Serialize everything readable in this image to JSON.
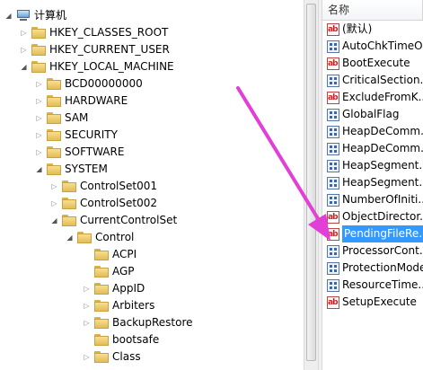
{
  "tree": {
    "items": [
      {
        "label": "计算机",
        "icon": "computer-icon",
        "expander": "expanded",
        "level": 0
      },
      {
        "label": "HKEY_CLASSES_ROOT",
        "icon": "folder-icon",
        "expander": "collapsed",
        "level": 1
      },
      {
        "label": "HKEY_CURRENT_USER",
        "icon": "folder-icon",
        "expander": "collapsed",
        "level": 1
      },
      {
        "label": "HKEY_LOCAL_MACHINE",
        "icon": "folder-icon",
        "expander": "expanded",
        "level": 1
      },
      {
        "label": "BCD00000000",
        "icon": "folder-icon",
        "expander": "collapsed",
        "level": 2
      },
      {
        "label": "HARDWARE",
        "icon": "folder-icon",
        "expander": "collapsed",
        "level": 2
      },
      {
        "label": "SAM",
        "icon": "folder-icon",
        "expander": "collapsed",
        "level": 2
      },
      {
        "label": "SECURITY",
        "icon": "folder-icon",
        "expander": "collapsed",
        "level": 2
      },
      {
        "label": "SOFTWARE",
        "icon": "folder-icon",
        "expander": "collapsed",
        "level": 2
      },
      {
        "label": "SYSTEM",
        "icon": "folder-icon",
        "expander": "expanded",
        "level": 2
      },
      {
        "label": "ControlSet001",
        "icon": "folder-icon",
        "expander": "collapsed",
        "level": 3
      },
      {
        "label": "ControlSet002",
        "icon": "folder-icon",
        "expander": "collapsed",
        "level": 3
      },
      {
        "label": "CurrentControlSet",
        "icon": "folder-icon",
        "expander": "expanded",
        "level": 3
      },
      {
        "label": "Control",
        "icon": "folder-icon",
        "expander": "expanded",
        "level": 4
      },
      {
        "label": "ACPI",
        "icon": "folder-icon",
        "expander": "none",
        "level": 5
      },
      {
        "label": "AGP",
        "icon": "folder-icon",
        "expander": "none",
        "level": 5
      },
      {
        "label": "AppID",
        "icon": "folder-icon",
        "expander": "collapsed",
        "level": 5
      },
      {
        "label": "Arbiters",
        "icon": "folder-icon",
        "expander": "collapsed",
        "level": 5
      },
      {
        "label": "BackupRestore",
        "icon": "folder-icon",
        "expander": "collapsed",
        "level": 5
      },
      {
        "label": "bootsafe",
        "icon": "folder-icon",
        "expander": "none",
        "level": 5
      },
      {
        "label": "Class",
        "icon": "folder-icon",
        "expander": "collapsed",
        "level": 5
      }
    ]
  },
  "list": {
    "header": "名称",
    "values": [
      {
        "name": "(默认)",
        "type": "sz",
        "selected": false
      },
      {
        "name": "AutoChkTimeO...",
        "type": "bin",
        "selected": false
      },
      {
        "name": "BootExecute",
        "type": "sz",
        "selected": false
      },
      {
        "name": "CriticalSection...",
        "type": "bin",
        "selected": false
      },
      {
        "name": "ExcludeFromK...",
        "type": "sz",
        "selected": false
      },
      {
        "name": "GlobalFlag",
        "type": "bin",
        "selected": false
      },
      {
        "name": "HeapDeComm...",
        "type": "bin",
        "selected": false
      },
      {
        "name": "HeapDeComm...",
        "type": "bin",
        "selected": false
      },
      {
        "name": "HeapSegment...",
        "type": "bin",
        "selected": false
      },
      {
        "name": "HeapSegment...",
        "type": "bin",
        "selected": false
      },
      {
        "name": "NumberOfIniti...",
        "type": "bin",
        "selected": false
      },
      {
        "name": "ObjectDirector...",
        "type": "sz",
        "selected": false
      },
      {
        "name": "PendingFileRe...",
        "type": "sz",
        "selected": true
      },
      {
        "name": "ProcessorCont...",
        "type": "bin",
        "selected": false
      },
      {
        "name": "ProtectionMode",
        "type": "bin",
        "selected": false
      },
      {
        "name": "ResourceTime...",
        "type": "bin",
        "selected": false
      },
      {
        "name": "SetupExecute",
        "type": "sz",
        "selected": false
      }
    ]
  },
  "colors": {
    "selection": "#3399ff",
    "annotation_arrow": "#e23fd8"
  }
}
